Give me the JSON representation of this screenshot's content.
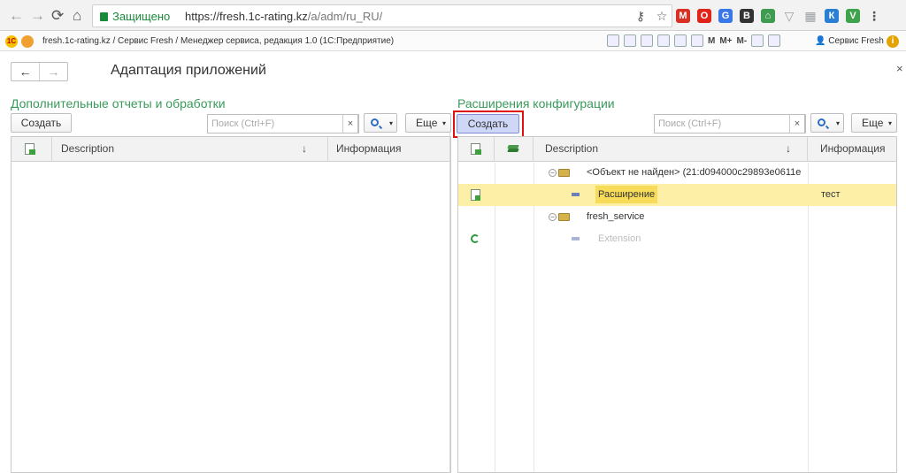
{
  "browser": {
    "secure_label": "Защищено",
    "url_host": "https://fresh.1c-rating.kz",
    "url_path": "/a/adm/ru_RU/",
    "extensions": [
      {
        "name": "key-icon",
        "color": "#555555",
        "glyph": "⚷"
      },
      {
        "name": "star-icon",
        "color": "#555555",
        "glyph": "☆"
      },
      {
        "name": "gmail-icon",
        "color": "#d93025",
        "glyph": "M"
      },
      {
        "name": "opera-icon",
        "color": "#e0241b",
        "glyph": "O"
      },
      {
        "name": "translate-icon",
        "color": "#3b78e7",
        "glyph": "G"
      },
      {
        "name": "b-icon",
        "color": "#333333",
        "glyph": "B"
      },
      {
        "name": "home-icon",
        "color": "#3f9b4f",
        "glyph": "⌂"
      },
      {
        "name": "shield-icon",
        "color": "#9aa0a6",
        "glyph": "▽"
      },
      {
        "name": "grid-icon",
        "color": "#9aa0a6",
        "glyph": "▦"
      },
      {
        "name": "k-icon",
        "color": "#2a7fd4",
        "glyph": "К"
      },
      {
        "name": "v-icon",
        "color": "#3fa34d",
        "glyph": "V"
      },
      {
        "name": "menu-icon",
        "color": "#555555",
        "glyph": "⋮"
      }
    ]
  },
  "appbar": {
    "title": "fresh.1c-rating.kz / Сервис Fresh / Менеджер сервиса, редакция 1.0  (1С:Предприятие)",
    "m_label": "M",
    "mplus_label": "M+",
    "mminus_label": "M-",
    "user": "Сервис Fresh",
    "info_glyph": "i"
  },
  "page": {
    "back": "←",
    "forward": "→",
    "title": "Адаптация приложений",
    "close": "×"
  },
  "left": {
    "section_title": "Дополнительные отчеты и обработки",
    "create_label": "Создать",
    "search_placeholder": "Поиск (Ctrl+F)",
    "clear": "×",
    "more_label": "Еще",
    "col_description": "Description",
    "sort_arrow": "↓",
    "col_info": "Информация"
  },
  "right": {
    "section_title": "Расширения конфигурации",
    "create_label": "Создать",
    "search_placeholder": "Поиск (Ctrl+F)",
    "clear": "×",
    "more_label": "Еще",
    "col_description": "Description",
    "sort_arrow": "↓",
    "col_info": "Информация",
    "rows": [
      {
        "description": "<Объект не найден> (21:d094000c29893e0611e",
        "info": ""
      },
      {
        "description": "Расширение",
        "info": "тест"
      },
      {
        "description": "fresh_service",
        "info": ""
      },
      {
        "description": "Extension",
        "info": ""
      }
    ]
  }
}
